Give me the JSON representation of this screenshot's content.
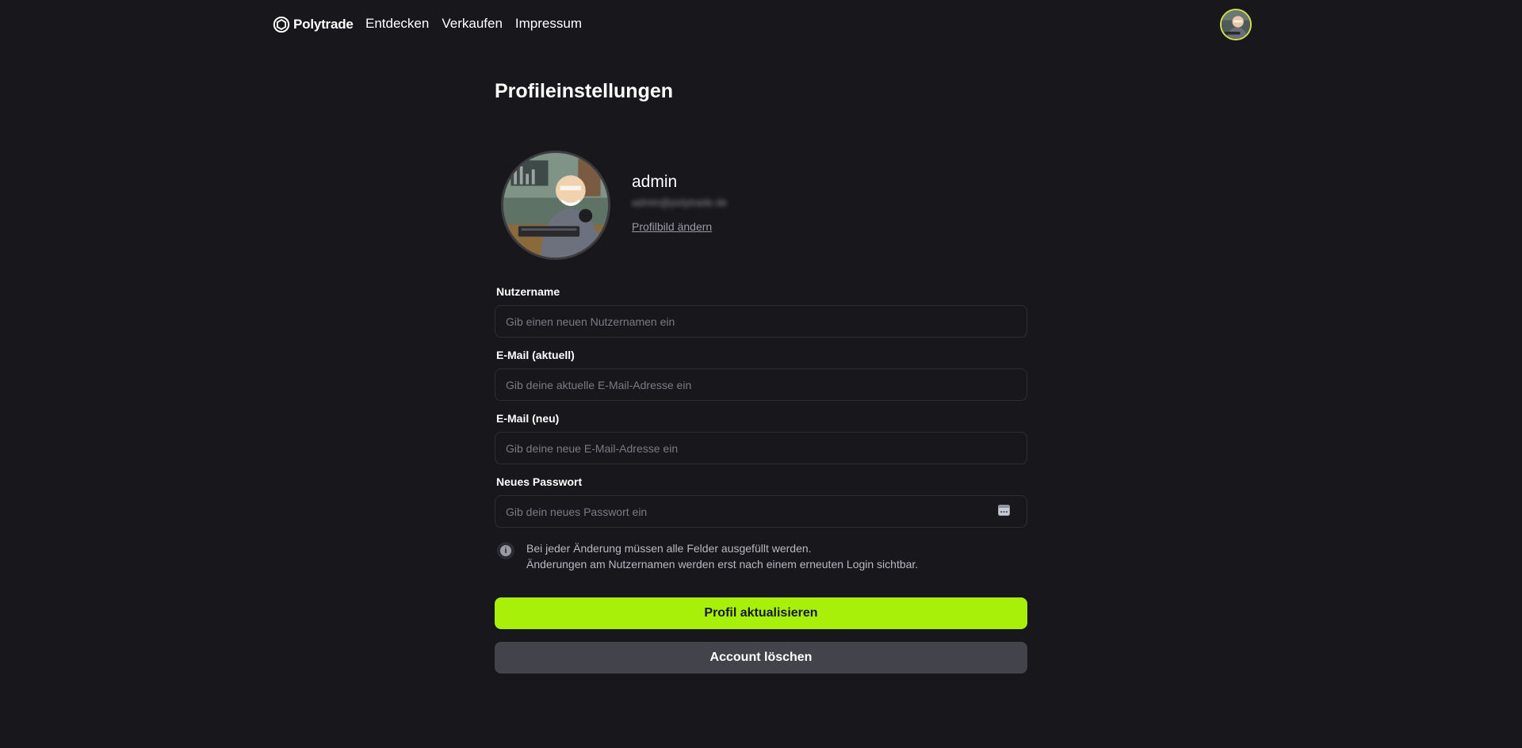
{
  "nav": {
    "brand": "Polytrade",
    "links": [
      "Entdecken",
      "Verkaufen",
      "Impressum"
    ]
  },
  "page": {
    "title": "Profileinstellungen"
  },
  "profile": {
    "name": "admin",
    "email": "admin@polytrade.de",
    "change_picture": "Profilbild ändern"
  },
  "form": {
    "username": {
      "label": "Nutzername",
      "placeholder": "Gib einen neuen Nutzernamen ein"
    },
    "email_current": {
      "label": "E-Mail (aktuell)",
      "placeholder": "Gib deine aktuelle E-Mail-Adresse ein"
    },
    "email_new": {
      "label": "E-Mail (neu)",
      "placeholder": "Gib deine neue E-Mail-Adresse ein"
    },
    "password": {
      "label": "Neues Passwort",
      "placeholder": "Gib dein neues Passwort ein"
    }
  },
  "info": {
    "line1": "Bei jeder Änderung müssen alle Felder ausgefüllt werden.",
    "line2": "Änderungen am Nutzernamen werden erst nach einem erneuten Login sichtbar."
  },
  "buttons": {
    "update": "Profil aktualisieren",
    "delete": "Account löschen"
  },
  "colors": {
    "background": "#18181c",
    "accent": "#a8f00a",
    "secondary_button": "#43434b",
    "avatar_ring": "#d4e04a"
  },
  "icons": {
    "brand": "polytrade-logo-icon",
    "info": "info-icon",
    "password": "password-manager-icon"
  }
}
